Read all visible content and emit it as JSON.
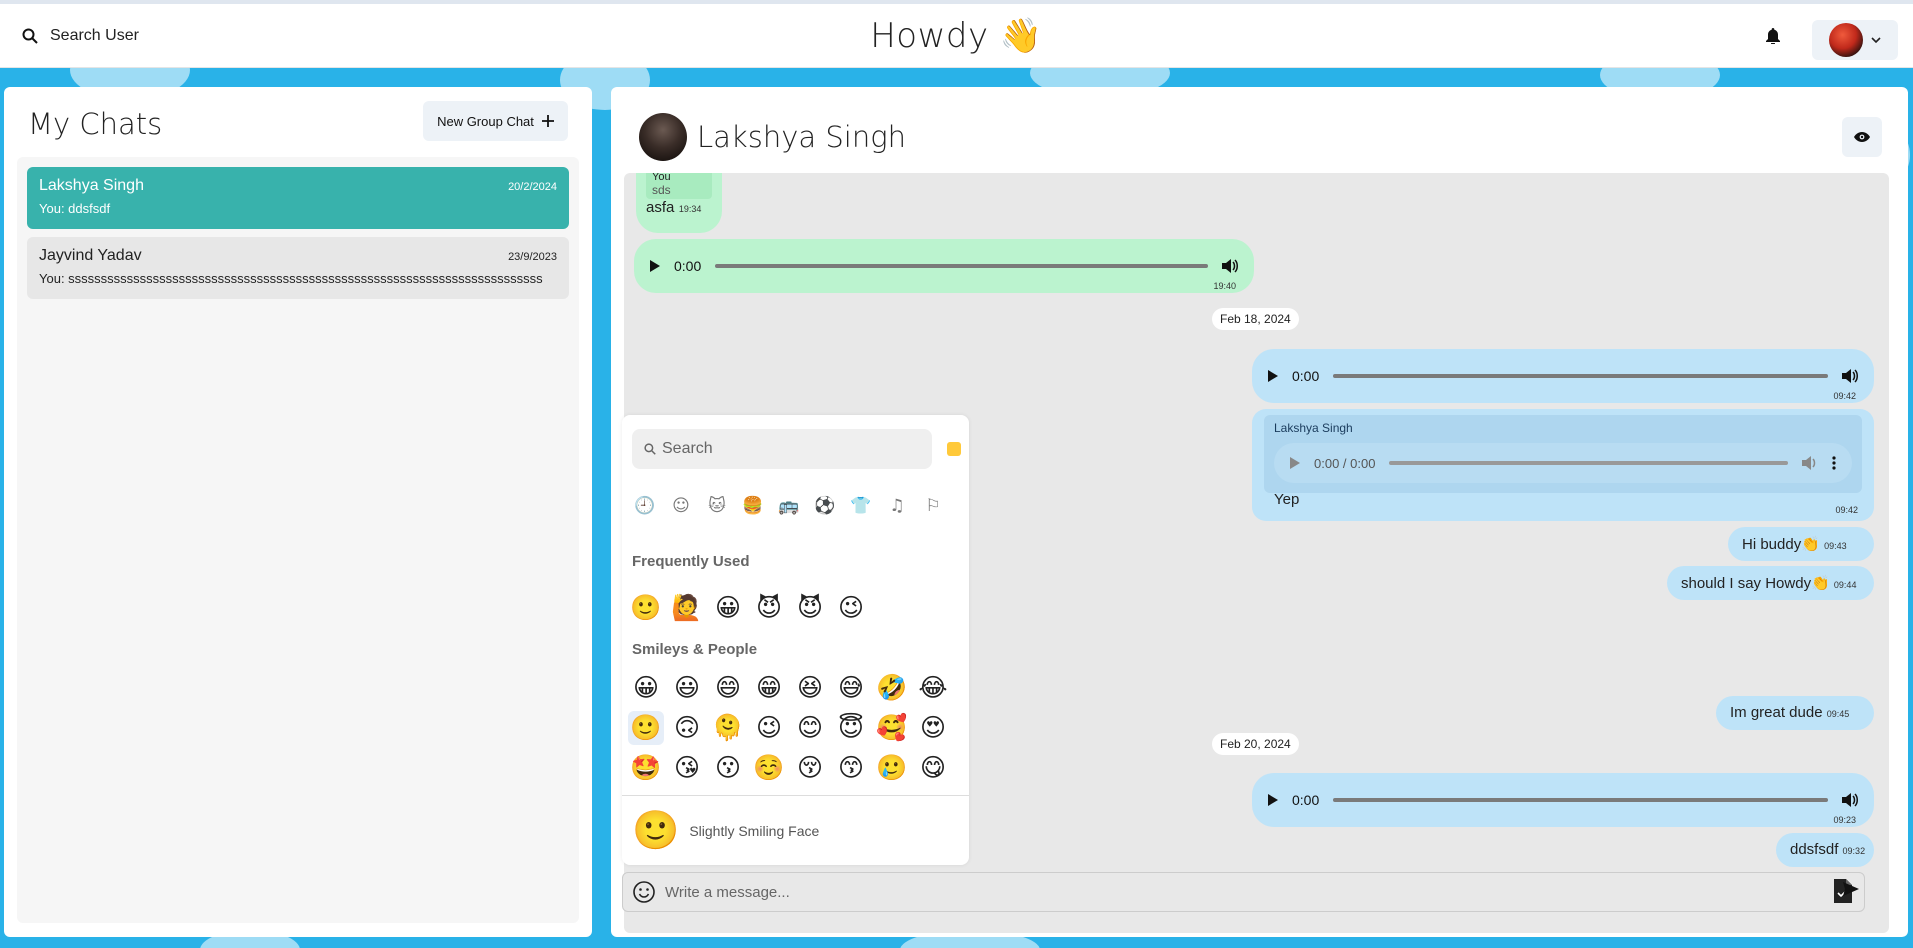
{
  "app": {
    "title": "Howdy 👋"
  },
  "search_user": {
    "label": "Search User",
    "icon": "search-icon"
  },
  "sidebar": {
    "title": "My Chats",
    "new_group_label": "New Group Chat",
    "chats": [
      {
        "name": "Lakshya Singh",
        "date": "20/2/2024",
        "preview": "You: ddsfsdf",
        "active": true
      },
      {
        "name": "Jayvind Yadav",
        "date": "23/9/2023",
        "preview": "You: sssssssssssssssssssssssssssssssssssssssssssssssssssssssssssssssssssssssss",
        "active": false
      }
    ]
  },
  "chat": {
    "name": "Lakshya Singh",
    "reply_top": {
      "author": "You",
      "text": "sds",
      "body": "asfa",
      "time": "19:34"
    },
    "audio1": {
      "time_label": "0:00",
      "stamp": "19:40"
    },
    "date1": "Feb 18, 2024",
    "audio2": {
      "time_label": "0:00",
      "stamp": "09:42"
    },
    "reply_msg": {
      "author": "Lakshya Singh",
      "audio_label": "0:00 / 0:00",
      "body": "Yep",
      "time": "09:42"
    },
    "msg_hi": {
      "text": "Hi buddy👏",
      "time": "09:43"
    },
    "msg_howdy": {
      "text": "should I say Howdy👏",
      "time": "09:44"
    },
    "msg_great": {
      "text": "Im great dude",
      "time": "09:45"
    },
    "date2": "Feb 20, 2024",
    "audio3": {
      "time_label": "0:00",
      "stamp": "09:23"
    },
    "msg_last": {
      "text": "ddsfsdf",
      "time": "09:32"
    }
  },
  "emoji_picker": {
    "search_placeholder": "Search",
    "categories": [
      "🕘",
      "☺",
      "🐱",
      "🍔",
      "🚌",
      "⚽",
      "👕",
      "♫",
      "⚐"
    ],
    "frequent_label": "Frequently Used",
    "frequent": [
      "🙂",
      "🙋",
      "😀",
      "😈",
      "😈",
      "😉"
    ],
    "smileys_label": "Smileys & People",
    "smileys": [
      "😀",
      "😃",
      "😄",
      "😁",
      "😆",
      "😅",
      "🤣",
      "😂",
      "🙂",
      "🙃",
      "🫠",
      "😉",
      "😊",
      "😇",
      "🥰",
      "😍",
      "🤩",
      "😘",
      "😗",
      "☺️",
      "😚",
      "😙",
      "🥲",
      "😋"
    ],
    "preview_emoji": "🙂",
    "preview_name": "Slightly Smiling Face"
  },
  "composer": {
    "placeholder": "Write a message..."
  },
  "colors": {
    "accent": "#38b2ac",
    "green_bubble": "#bbf3cf",
    "blue_bubble": "#bee3f8",
    "background": "#29b2e8"
  }
}
